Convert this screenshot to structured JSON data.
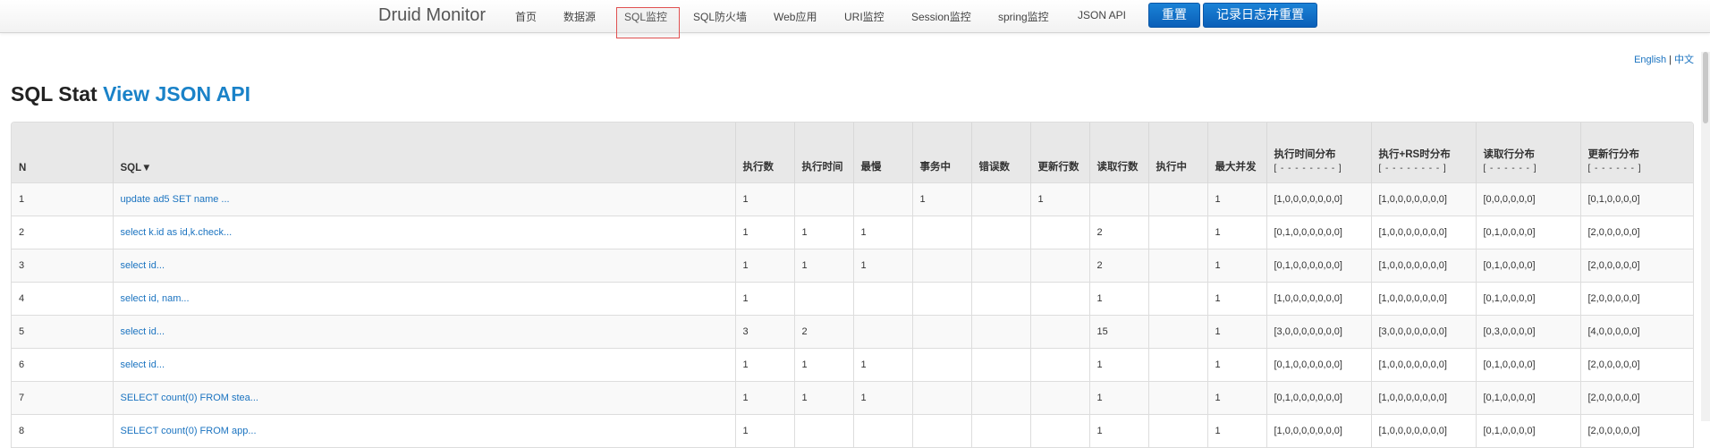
{
  "navbar": {
    "brand": "Druid Monitor",
    "items": [
      {
        "label": "首页"
      },
      {
        "label": "数据源"
      },
      {
        "label": "SQL监控"
      },
      {
        "label": "SQL防火墙"
      },
      {
        "label": "Web应用"
      },
      {
        "label": "URI监控"
      },
      {
        "label": "Session监控"
      },
      {
        "label": "spring监控"
      },
      {
        "label": "JSON API"
      }
    ],
    "active": "SQL监控",
    "reset_button": "重置",
    "log_reset_button": "记录日志并重置"
  },
  "lang": {
    "english": "English",
    "separator": "|",
    "chinese": "中文"
  },
  "page": {
    "title": "SQL Stat",
    "title_link": "View JSON API"
  },
  "table": {
    "headers": [
      {
        "label": "N"
      },
      {
        "label": "SQL▼"
      },
      {
        "label": "执行数"
      },
      {
        "label": "执行时间"
      },
      {
        "label": "最慢"
      },
      {
        "label": "事务中"
      },
      {
        "label": "错误数"
      },
      {
        "label": "更新行数"
      },
      {
        "label": "读取行数"
      },
      {
        "label": "执行中"
      },
      {
        "label": "最大并发"
      },
      {
        "label": "执行时间分布",
        "sub": "[ - - - - - - - - ]"
      },
      {
        "label": "执行+RS时分布",
        "sub": "[ - - - - - - - - ]"
      },
      {
        "label": "读取行分布",
        "sub": "[ - - - - - - ]"
      },
      {
        "label": "更新行分布",
        "sub": "[ - - - - - - ]"
      }
    ],
    "rows": [
      [
        "1",
        "update ad5 SET name ...",
        "1",
        "",
        "",
        "1",
        "",
        "1",
        "",
        "",
        "1",
        "[1,0,0,0,0,0,0,0]",
        "[1,0,0,0,0,0,0,0]",
        "[0,0,0,0,0,0]",
        "[0,1,0,0,0,0]"
      ],
      [
        "2",
        "select k.id as id,k.check...",
        "1",
        "1",
        "1",
        "",
        "",
        "",
        "2",
        "",
        "1",
        "[0,1,0,0,0,0,0,0]",
        "[1,0,0,0,0,0,0,0]",
        "[0,1,0,0,0,0]",
        "[2,0,0,0,0,0]"
      ],
      [
        "3",
        "select id...",
        "1",
        "1",
        "1",
        "",
        "",
        "",
        "2",
        "",
        "1",
        "[0,1,0,0,0,0,0,0]",
        "[1,0,0,0,0,0,0,0]",
        "[0,1,0,0,0,0]",
        "[2,0,0,0,0,0]"
      ],
      [
        "4",
        "select id, nam...",
        "1",
        "",
        "",
        "",
        "",
        "",
        "1",
        "",
        "1",
        "[1,0,0,0,0,0,0,0]",
        "[1,0,0,0,0,0,0,0]",
        "[0,1,0,0,0,0]",
        "[2,0,0,0,0,0]"
      ],
      [
        "5",
        "select id...",
        "3",
        "2",
        "",
        "",
        "",
        "",
        "15",
        "",
        "1",
        "[3,0,0,0,0,0,0,0]",
        "[3,0,0,0,0,0,0,0]",
        "[0,3,0,0,0,0]",
        "[4,0,0,0,0,0]"
      ],
      [
        "6",
        "select id...",
        "1",
        "1",
        "1",
        "",
        "",
        "",
        "1",
        "",
        "1",
        "[0,1,0,0,0,0,0,0]",
        "[1,0,0,0,0,0,0,0]",
        "[0,1,0,0,0,0]",
        "[2,0,0,0,0,0]"
      ],
      [
        "7",
        "SELECT count(0) FROM stea...",
        "1",
        "1",
        "1",
        "",
        "",
        "",
        "1",
        "",
        "1",
        "[0,1,0,0,0,0,0,0]",
        "[1,0,0,0,0,0,0,0]",
        "[0,1,0,0,0,0]",
        "[2,0,0,0,0,0]"
      ],
      [
        "8",
        "SELECT count(0) FROM app...",
        "1",
        "",
        "",
        "",
        "",
        "",
        "1",
        "",
        "1",
        "[1,0,0,0,0,0,0,0]",
        "[1,0,0,0,0,0,0,0]",
        "[0,1,0,0,0,0]",
        "[2,0,0,0,0,0]"
      ]
    ]
  },
  "colors": {
    "link": "#1a73c0",
    "button": "#0a5fb8",
    "active_outline": "#e05050"
  }
}
